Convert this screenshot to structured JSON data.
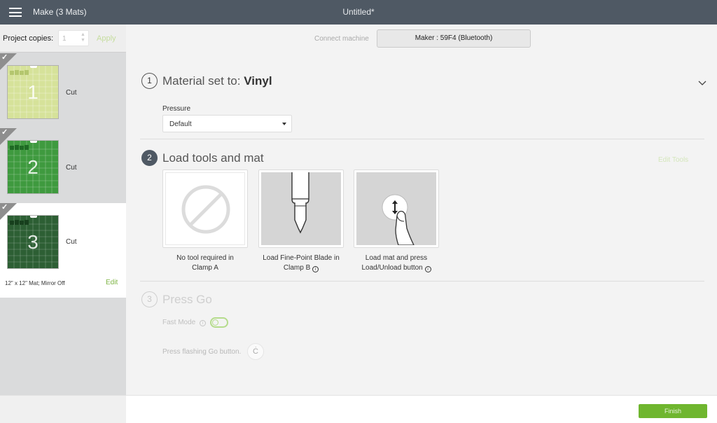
{
  "header": {
    "app_title": "Make (3 Mats)",
    "doc_title": "Untitled*"
  },
  "sidebar": {
    "copies_label": "Project copies:",
    "copies_value": "1",
    "apply_label": "Apply",
    "mats": [
      {
        "number": "1",
        "action": "Cut",
        "color": "#d6e29a",
        "checked": true
      },
      {
        "number": "2",
        "action": "Cut",
        "color": "#3f9a3f",
        "checked": true
      },
      {
        "number": "3",
        "action": "Cut",
        "color": "#2d5f34",
        "checked": true,
        "selected": true
      }
    ],
    "mat_info": "12\" x 12\" Mat; Mirror Off",
    "edit_label": "Edit"
  },
  "machine": {
    "connect_label": "Connect machine",
    "machine_name": "Maker : 59F4 (Bluetooth)"
  },
  "step1": {
    "number": "1",
    "title_prefix": "Material set to: ",
    "material": "Vinyl",
    "pressure_label": "Pressure",
    "pressure_value": "Default"
  },
  "step2": {
    "number": "2",
    "title": "Load tools and mat",
    "edit_tools_label": "Edit Tools",
    "tools": [
      {
        "icon": "no-tool-icon",
        "caption_line1": "No tool required in",
        "caption_line2": "Clamp A"
      },
      {
        "icon": "fine-point-blade-icon",
        "caption_line1": "Load Fine-Point Blade in",
        "caption_line2": "Clamp B"
      },
      {
        "icon": "load-mat-icon",
        "caption_line1": "Load mat and press",
        "caption_line2": "Load/Unload button"
      }
    ]
  },
  "step3": {
    "number": "3",
    "title": "Press Go",
    "fast_mode_label": "Fast Mode",
    "fast_mode_on": false,
    "press_go_text": "Press flashing Go button."
  },
  "footer": {
    "finish_label": "Finish"
  },
  "colors": {
    "topbar": "#4f5964",
    "accent_green": "#6fb62f"
  }
}
